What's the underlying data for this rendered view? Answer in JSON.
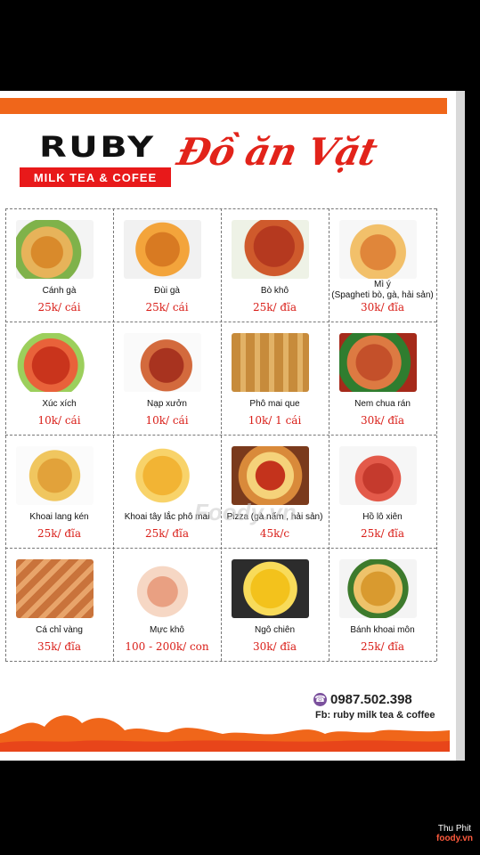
{
  "header": {
    "brand": "RUBY",
    "sub": "MILK TEA & COFEE",
    "title": "Đồ ăn Vặt"
  },
  "watermark": "Foody.vn",
  "items": [
    {
      "name": "Cánh gà",
      "price": "25k/ cái"
    },
    {
      "name": "Đùi gà",
      "price": "25k/ cái"
    },
    {
      "name": "Bò khô",
      "price": "25k/ đĩa"
    },
    {
      "name": "Mì ý\n(Spagheti bò, gà, hải sản)",
      "price": "30k/ đĩa"
    },
    {
      "name": "Xúc xích",
      "price": "10k/ cái"
    },
    {
      "name": "Nạp xưởn",
      "price": "10k/ cái"
    },
    {
      "name": "Phô mai que",
      "price": "10k/ 1 cái"
    },
    {
      "name": "Nem chua rán",
      "price": "30k/ đĩa"
    },
    {
      "name": "Khoai lang kén",
      "price": "25k/ đĩa"
    },
    {
      "name": "Khoai tây lắc phô mai",
      "price": "25k/ đĩa"
    },
    {
      "name": "Pizza (gà nấm , hải sản)",
      "price": "45k/c"
    },
    {
      "name": "Hồ lô xiên",
      "price": "25k/ đĩa"
    },
    {
      "name": "Cá chỉ vàng",
      "price": "35k/ đĩa"
    },
    {
      "name": "Mực khô",
      "price": "100 - 200k/ con"
    },
    {
      "name": "Ngô chiên",
      "price": "30k/ đĩa"
    },
    {
      "name": "Bánh khoai môn",
      "price": "25k/ đĩa"
    }
  ],
  "contact": {
    "phone": "0987.502.398",
    "fb": "Fb: ruby milk tea & coffee"
  },
  "corner": {
    "user": "Thu Phit",
    "brand": "foody.vn"
  },
  "colors": {
    "accent": "#e2231a",
    "orange": "#f0661a"
  }
}
